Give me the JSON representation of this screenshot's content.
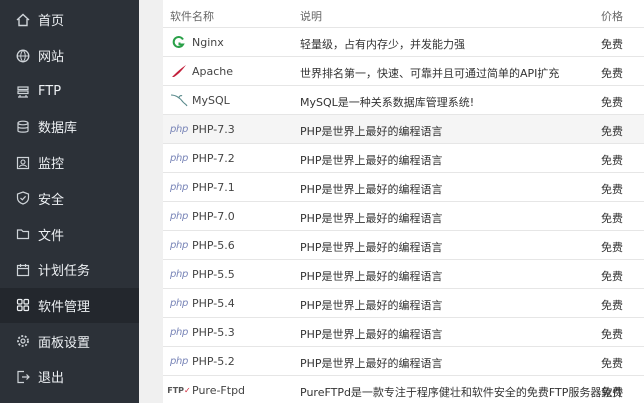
{
  "sidebar": {
    "items": [
      {
        "label": "首页",
        "icon": "home-icon",
        "active": false
      },
      {
        "label": "网站",
        "icon": "globe-icon",
        "active": false
      },
      {
        "label": "FTP",
        "icon": "ftp-icon",
        "active": false
      },
      {
        "label": "数据库",
        "icon": "database-icon",
        "active": false
      },
      {
        "label": "监控",
        "icon": "monitor-icon",
        "active": false
      },
      {
        "label": "安全",
        "icon": "shield-icon",
        "active": false
      },
      {
        "label": "文件",
        "icon": "folder-icon",
        "active": false
      },
      {
        "label": "计划任务",
        "icon": "calendar-icon",
        "active": false
      },
      {
        "label": "软件管理",
        "icon": "grid-icon",
        "active": true
      },
      {
        "label": "面板设置",
        "icon": "gear-icon",
        "active": false
      },
      {
        "label": "退出",
        "icon": "logout-icon",
        "active": false
      }
    ]
  },
  "table": {
    "headers": {
      "name": "软件名称",
      "desc": "说明",
      "price": "价格"
    },
    "rows": [
      {
        "icon": "nginx-icon",
        "name": "Nginx",
        "desc": "轻量级，占有内存少，并发能力强",
        "price": "免费"
      },
      {
        "icon": "apache-icon",
        "name": "Apache",
        "desc": "世界排名第一，快速、可靠并且可通过简单的API扩充",
        "price": "免费"
      },
      {
        "icon": "mysql-icon",
        "name": "MySQL",
        "desc": "MySQL是一种关系数据库管理系统!",
        "price": "免费"
      },
      {
        "icon": "php-icon",
        "name": "PHP-7.3",
        "desc": "PHP是世界上最好的编程语言",
        "price": "免费"
      },
      {
        "icon": "php-icon",
        "name": "PHP-7.2",
        "desc": "PHP是世界上最好的编程语言",
        "price": "免费"
      },
      {
        "icon": "php-icon",
        "name": "PHP-7.1",
        "desc": "PHP是世界上最好的编程语言",
        "price": "免费"
      },
      {
        "icon": "php-icon",
        "name": "PHP-7.0",
        "desc": "PHP是世界上最好的编程语言",
        "price": "免费"
      },
      {
        "icon": "php-icon",
        "name": "PHP-5.6",
        "desc": "PHP是世界上最好的编程语言",
        "price": "免费"
      },
      {
        "icon": "php-icon",
        "name": "PHP-5.5",
        "desc": "PHP是世界上最好的编程语言",
        "price": "免费"
      },
      {
        "icon": "php-icon",
        "name": "PHP-5.4",
        "desc": "PHP是世界上最好的编程语言",
        "price": "免费"
      },
      {
        "icon": "php-icon",
        "name": "PHP-5.3",
        "desc": "PHP是世界上最好的编程语言",
        "price": "免费"
      },
      {
        "icon": "php-icon",
        "name": "PHP-5.2",
        "desc": "PHP是世界上最好的编程语言",
        "price": "免费"
      },
      {
        "icon": "ftp-logo-icon",
        "name": "Pure-Ftpd",
        "desc": "PureFTPd是一款专注于程序健壮和软件安全的免费FTP服务器软件",
        "price": "免费"
      }
    ],
    "icon_text": {
      "php": "php",
      "ftp_a": "FTP",
      "ftp_b": "✓"
    }
  }
}
